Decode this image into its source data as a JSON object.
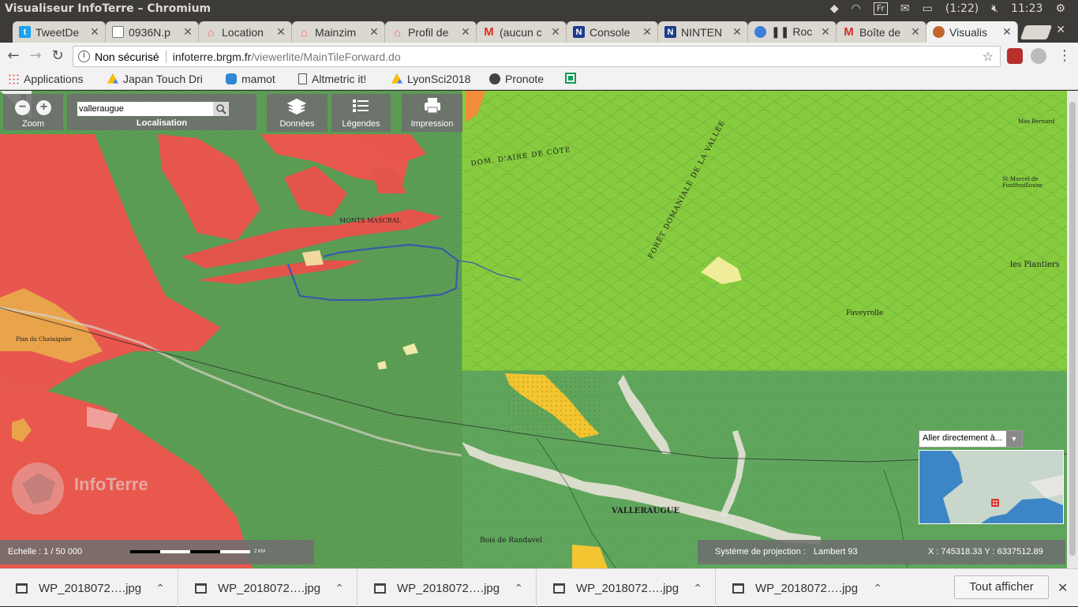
{
  "os": {
    "window_title": "Visualiseur InfoTerre – Chromium",
    "keyboard_layout": "Fr",
    "battery": "(1:22)",
    "clock": "11:23"
  },
  "tabs": [
    {
      "label": "TweetDe",
      "favicon_color": "#1da1f2",
      "favicon": "twitter-icon"
    },
    {
      "label": "0936N.p",
      "favicon_color": "#777777",
      "favicon": "document-icon"
    },
    {
      "label": "Location",
      "favicon_color": "#ff5a5f",
      "favicon": "airbnb-icon"
    },
    {
      "label": "Mainzim",
      "favicon_color": "#ff5a5f",
      "favicon": "airbnb-icon"
    },
    {
      "label": "Profil de",
      "favicon_color": "#ff5a5f",
      "favicon": "airbnb-icon"
    },
    {
      "label": "(aucun c",
      "favicon_color": "#d93025",
      "favicon": "gmail-icon"
    },
    {
      "label": "Console",
      "favicon_color": "#1a3d8f",
      "favicon": "nintendo-icon"
    },
    {
      "label": "NINTEN",
      "favicon_color": "#1a3d8f",
      "favicon": "nintendo-icon"
    },
    {
      "label": "❚❚ Roc",
      "favicon_color": "#3b7dd8",
      "favicon": "media-icon"
    },
    {
      "label": "Boîte de",
      "favicon_color": "#d93025",
      "favicon": "gmail-icon"
    },
    {
      "label": "Visualis",
      "favicon_color": "#c0652f",
      "favicon": "infoterre-icon",
      "active": true
    }
  ],
  "address_bar": {
    "security_label": "Non sécurisé",
    "url_host": "infoterre.brgm.fr",
    "url_path": "/viewerlite/MainTileForward.do"
  },
  "bookmarks": [
    {
      "label": "Applications",
      "icon": "apps-grid-icon"
    },
    {
      "label": "Japan Touch Dri",
      "icon": "google-drive-icon"
    },
    {
      "label": "mamot",
      "icon": "mastodon-icon"
    },
    {
      "label": "Altmetric it!",
      "icon": "page-icon"
    },
    {
      "label": "LyonSci2018",
      "icon": "google-drive-icon"
    },
    {
      "label": "Pronote",
      "icon": "pronote-icon"
    },
    {
      "label": "",
      "icon": "sheets-icon"
    }
  ],
  "map_controls": {
    "zoom_label": "Zoom",
    "search_value": "valleraugue",
    "localisation_label": "Localisation",
    "donnees_label": "Données",
    "legendes_label": "Légendes",
    "impression_label": "Impression",
    "goto_placeholder": "Aller directement à...",
    "scale_label": "Echelle : 1 / 50 000",
    "scale_bar_unit": "2 KM",
    "projection_label": "Système de projection :",
    "projection_value": "Lambert 93",
    "coordinates": "X : 745318.33 Y : 6337512.89",
    "watermark": "InfoTerre"
  },
  "map_labels": {
    "valleraugue": "VALLERAUGUE",
    "dom_aire": "DOM. D'AIRE DE CÔTE",
    "foret": "FORÊT DOMANIALE DE LA VALLÉE",
    "plantiers": "les Plantiers",
    "faveyrolle": "Faveyrolle",
    "ardaillers": "MONTS MASCRAL",
    "bois_randavel": "Bois de Randavel",
    "plan_chatagnier": "Plan du Chataignier",
    "mas_bernard": "Mas Bernard",
    "st_marcel": "St Marcel de Fontfouillouse"
  },
  "downloads": [
    {
      "label": "WP_2018072….jpg"
    },
    {
      "label": "WP_2018072….jpg"
    },
    {
      "label": "WP_2018072….jpg"
    },
    {
      "label": "WP_2018072….jpg"
    },
    {
      "label": "WP_2018072….jpg"
    }
  ],
  "downloads_show_all": "Tout afficher"
}
